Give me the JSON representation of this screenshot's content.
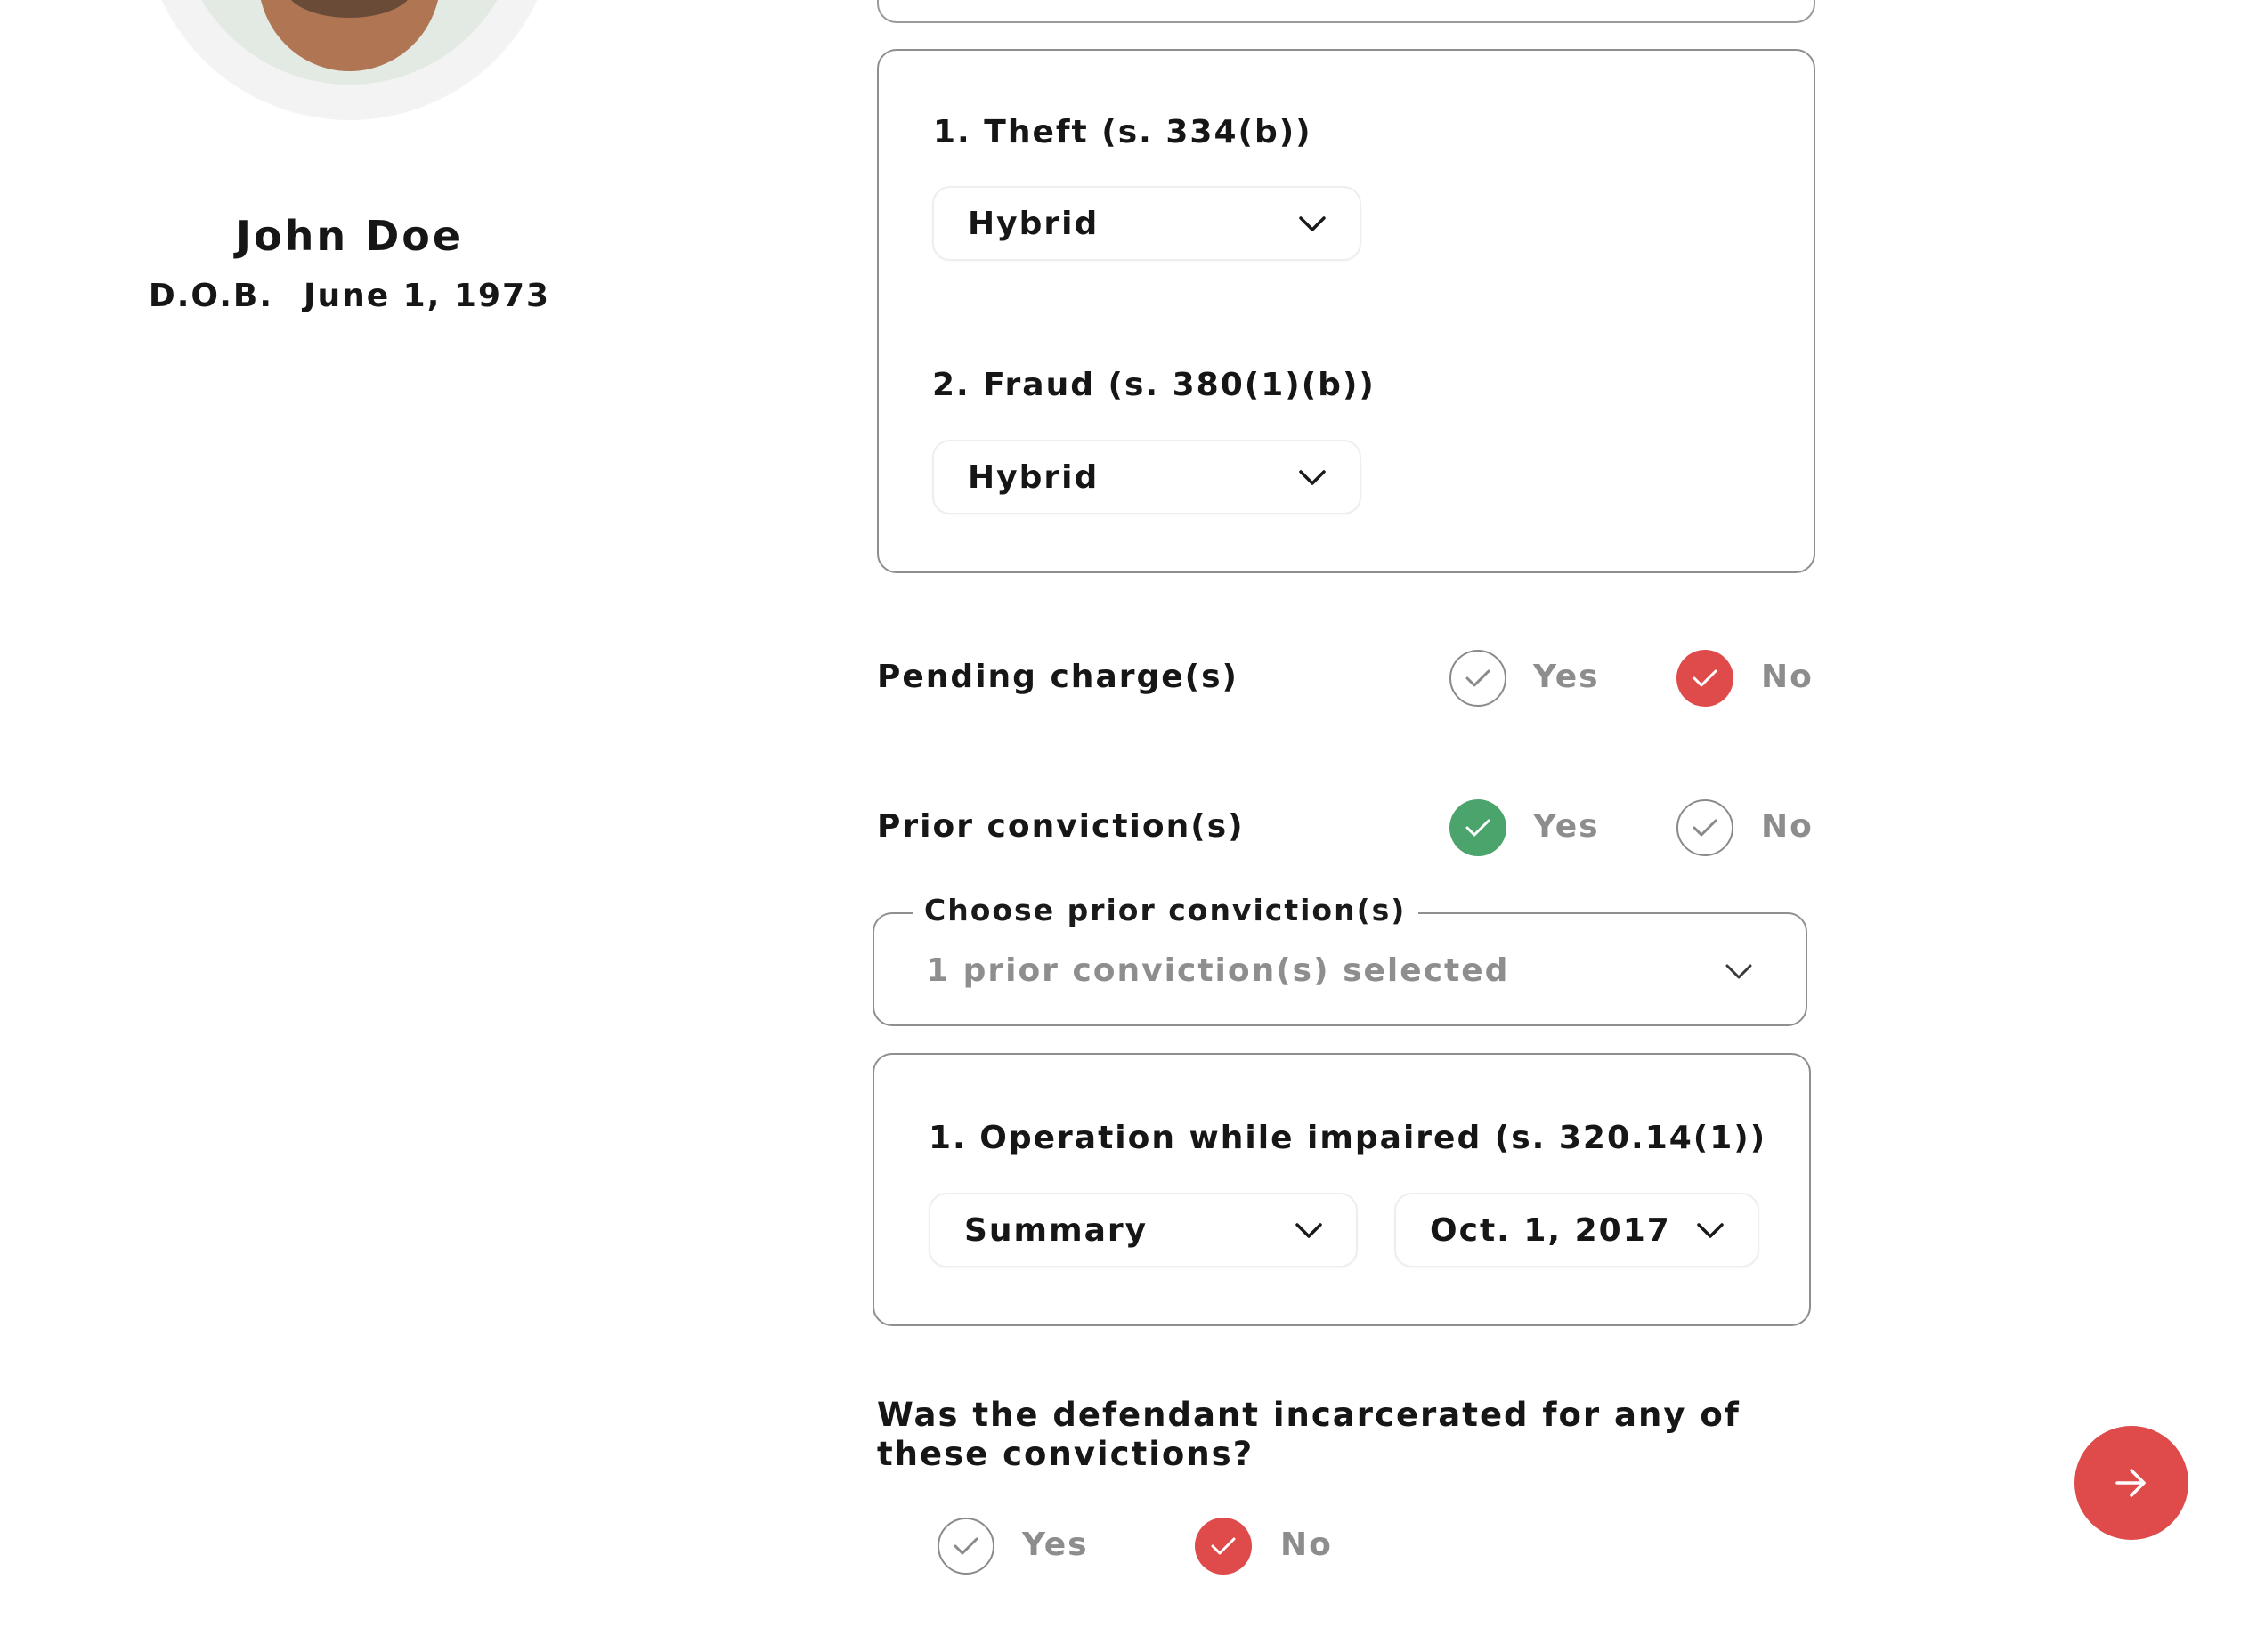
{
  "profile": {
    "name": "John Doe",
    "dob_label": "D.O.B.",
    "dob_value": "June 1, 1973"
  },
  "current_charges": [
    {
      "title": "1. Theft (s. 334(b))",
      "type": "Hybrid"
    },
    {
      "title": "2. Fraud (s. 380(1)(b))",
      "type": "Hybrid"
    }
  ],
  "pending_charges": {
    "label": "Pending charge(s)",
    "yes_label": "Yes",
    "no_label": "No",
    "selected": "No"
  },
  "prior_convictions": {
    "label": "Prior conviction(s)",
    "yes_label": "Yes",
    "no_label": "No",
    "selected": "Yes",
    "chooser_legend": "Choose prior conviction(s)",
    "chooser_value": "1 prior conviction(s) selected",
    "items": [
      {
        "title": "1. Operation while impaired (s. 320.14(1))",
        "type": "Summary",
        "date": "Oct. 1, 2017"
      }
    ]
  },
  "incarcerated": {
    "question": "Was the defendant incarcerated for any of these convictions?",
    "yes_label": "Yes",
    "no_label": "No",
    "selected": "No"
  },
  "icons": {
    "next": "arrow-right-icon",
    "dropdown": "chevron-down-icon",
    "check": "check-icon"
  },
  "colors": {
    "accent_red": "#df4a4a",
    "accent_green": "#4aa46c",
    "muted_text": "#8d8d8d"
  }
}
